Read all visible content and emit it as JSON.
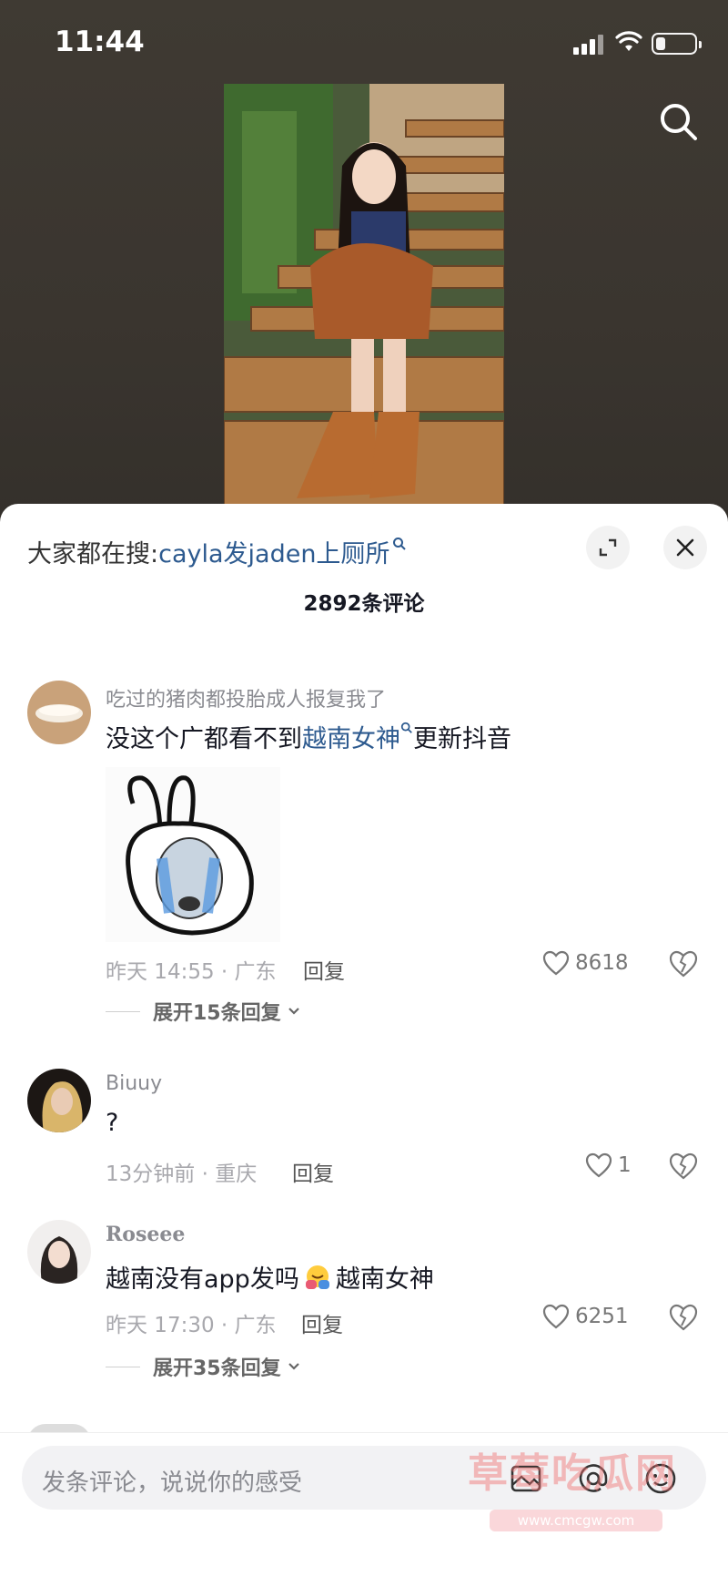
{
  "status_bar": {
    "time": "11:44",
    "icons": [
      "signal-icon",
      "wifi-icon",
      "battery-icon"
    ]
  },
  "top": {
    "search_icon": "search-icon"
  },
  "sheet": {
    "trend_prefix": "大家都在搜:",
    "trend_query": "cayla发jaden上厕所",
    "comment_count": "2892条评论",
    "buttons": [
      "expand-icon",
      "close-icon"
    ]
  },
  "comments": [
    {
      "username": "吃过的猪肉都投胎成人报复我了",
      "text_before": "没这个广都看不到",
      "text_link": "越南女神",
      "text_after": "更新抖音",
      "meta": "昨天 14:55 · 广东",
      "reply": "回复",
      "likes": "8618",
      "expand": "展开15条回复"
    },
    {
      "username": "Biuuy",
      "text": "?",
      "meta": "13分钟前 · 重庆",
      "reply": "回复",
      "likes": "1"
    },
    {
      "username": "Roseee",
      "text_before": "越南没有app发吗",
      "text_after": "越南女神",
      "meta": "昨天 17:30 · 广东",
      "reply": "回复",
      "likes": "6251",
      "expand": "展开35条回复"
    }
  ],
  "input": {
    "placeholder": "发条评论，说说你的感受",
    "icons": [
      "emoji-icon",
      "at-icon",
      "image-icon"
    ]
  },
  "watermark": {
    "text": "草莓吃瓜网",
    "url": "www.cmcgw.com"
  },
  "colors": {
    "link": "#2d5a8f",
    "top_bg": "#3b3630",
    "sheet_bg": "#ffffff"
  }
}
